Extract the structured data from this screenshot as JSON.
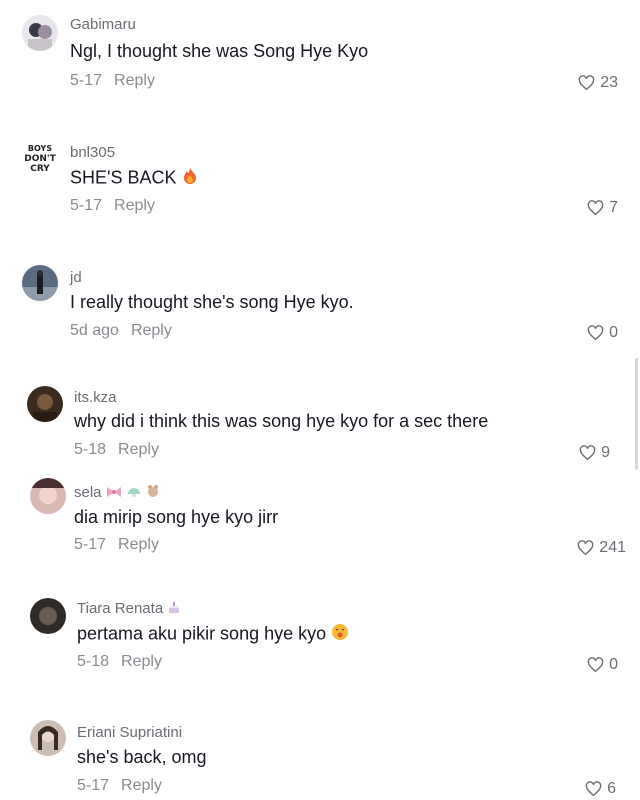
{
  "comments": [
    {
      "username": "Gabimaru",
      "text": "Ngl, I thought she was Song Hye Kyo",
      "date": "5-17",
      "reply": "Reply",
      "likes": "23",
      "avatar_icon": "anime-avatar"
    },
    {
      "username": "bnl305",
      "text": "SHE'S BACK",
      "date": "5-17",
      "reply": "Reply",
      "likes": "7",
      "avatar_icon": "boys-dont-cry-logo",
      "avatar_text": "BOYS DON'T CRY"
    },
    {
      "username": "jd",
      "text": "I really thought she's song Hye kyo.",
      "date": "5d ago",
      "reply": "Reply",
      "likes": "0",
      "avatar_icon": "person-photo-avatar"
    },
    {
      "username": "its.kza",
      "text": "why did i think this was song hye kyo for a sec there",
      "date": "5-18",
      "reply": "Reply",
      "likes": "9",
      "avatar_icon": "dark-photo-avatar"
    },
    {
      "username": "sela",
      "text": "dia mirip song hye kyo jirr",
      "date": "5-17",
      "reply": "Reply",
      "likes": "241",
      "avatar_icon": "face-photo-avatar"
    },
    {
      "username": "Tiara Renata",
      "text": "pertama aku pikir song hye kyo",
      "date": "5-18",
      "reply": "Reply",
      "likes": "0",
      "avatar_icon": "face-photo-avatar"
    },
    {
      "username": "Eriani Supriatini",
      "text": "she's back, omg",
      "date": "5-17",
      "reply": "Reply",
      "likes": "6",
      "avatar_icon": "face-photo-avatar"
    }
  ],
  "colors": {
    "text": "#161823",
    "muted": "#8a8b91",
    "username": "#6b6d75",
    "fire": "#f2622e"
  }
}
